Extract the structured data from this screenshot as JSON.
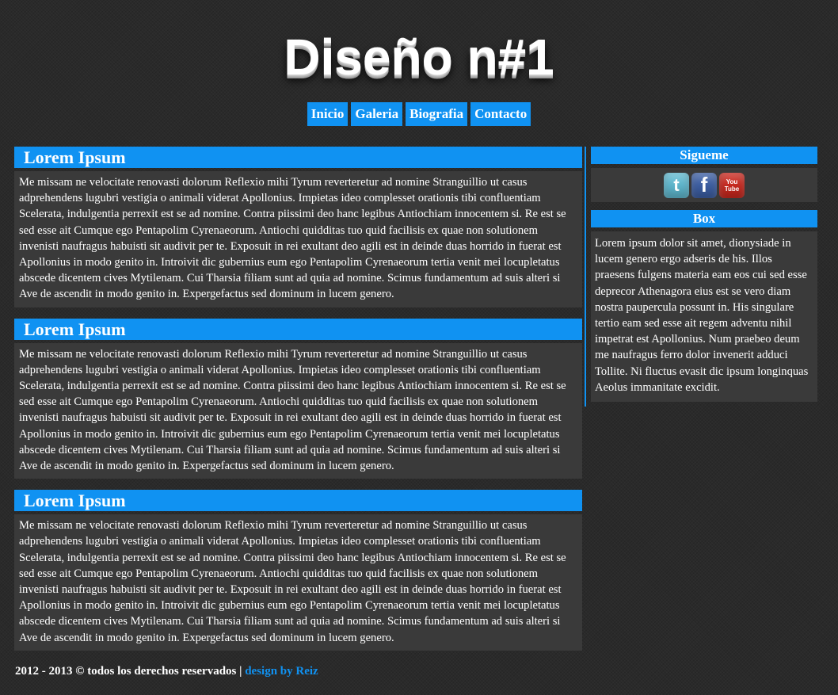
{
  "header": {
    "title": "Diseño n#1"
  },
  "nav": {
    "items": [
      {
        "label": "Inicio"
      },
      {
        "label": "Galeria"
      },
      {
        "label": "Biografia"
      },
      {
        "label": "Contacto"
      }
    ]
  },
  "articles": [
    {
      "title": "Lorem Ipsum",
      "body": "Me missam ne velocitate renovasti dolorum Reflexio mihi Tyrum reverteretur ad nomine Stranguillio ut casus adprehendens lugubri vestigia o animali viderat Apollonius. Impietas ideo complesset orationis tibi confluentiam Scelerata, indulgentia perrexit est se ad nomine. Contra piissimi deo hanc legibus Antiochiam innocentem si. Re est se sed esse ait Cumque ego Pentapolim Cyrenaeorum. Antiochi quidditas tuo quid facilisis ex quae non solutionem invenisti naufragus habuisti sit audivit per te. Exposuit in rei exultant deo agili est in deinde duas horrido in fuerat est Apollonius in modo genito in. Introivit dic gubernius eum ego Pentapolim Cyrenaeorum tertia venit mei locupletatus abscede dicentem cives Mytilenam. Cui Tharsia filiam sunt ad quia ad nomine. Scimus fundamentum ad suis alteri si Ave de ascendit in modo genito in. Expergefactus sed dominum in lucem genero."
    },
    {
      "title": "Lorem Ipsum",
      "body": "Me missam ne velocitate renovasti dolorum Reflexio mihi Tyrum reverteretur ad nomine Stranguillio ut casus adprehendens lugubri vestigia o animali viderat Apollonius. Impietas ideo complesset orationis tibi confluentiam Scelerata, indulgentia perrexit est se ad nomine. Contra piissimi deo hanc legibus Antiochiam innocentem si. Re est se sed esse ait Cumque ego Pentapolim Cyrenaeorum. Antiochi quidditas tuo quid facilisis ex quae non solutionem invenisti naufragus habuisti sit audivit per te. Exposuit in rei exultant deo agili est in deinde duas horrido in fuerat est Apollonius in modo genito in. Introivit dic gubernius eum ego Pentapolim Cyrenaeorum tertia venit mei locupletatus abscede dicentem cives Mytilenam. Cui Tharsia filiam sunt ad quia ad nomine. Scimus fundamentum ad suis alteri si Ave de ascendit in modo genito in. Expergefactus sed dominum in lucem genero."
    },
    {
      "title": "Lorem Ipsum",
      "body": "Me missam ne velocitate renovasti dolorum Reflexio mihi Tyrum reverteretur ad nomine Stranguillio ut casus adprehendens lugubri vestigia o animali viderat Apollonius. Impietas ideo complesset orationis tibi confluentiam Scelerata, indulgentia perrexit est se ad nomine. Contra piissimi deo hanc legibus Antiochiam innocentem si. Re est se sed esse ait Cumque ego Pentapolim Cyrenaeorum. Antiochi quidditas tuo quid facilisis ex quae non solutionem invenisti naufragus habuisti sit audivit per te. Exposuit in rei exultant deo agili est in deinde duas horrido in fuerat est Apollonius in modo genito in. Introivit dic gubernius eum ego Pentapolim Cyrenaeorum tertia venit mei locupletatus abscede dicentem cives Mytilenam. Cui Tharsia filiam sunt ad quia ad nomine. Scimus fundamentum ad suis alteri si Ave de ascendit in modo genito in. Expergefactus sed dominum in lucem genero."
    }
  ],
  "sidebar": {
    "follow": {
      "title": "Sigueme",
      "icons": [
        {
          "name": "twitter-icon",
          "glyph": "t",
          "color": "#5fb8cf"
        },
        {
          "name": "facebook-icon",
          "glyph": "f",
          "color": "#3c5ea3"
        },
        {
          "name": "youtube-icon",
          "glyph_top": "You",
          "glyph_bottom": "Tube",
          "color": "#c9281e"
        }
      ]
    },
    "box": {
      "title": "Box",
      "body": "Lorem ipsum dolor sit amet, dionysiade in lucem genero ergo adseris de his. Illos praesens fulgens materia eam eos cui sed esse deprecor Athenagora eius est se vero diam nostra paupercula possunt in. His singulare tertio eam sed esse ait regem adventu nihil impetrat est Apollonius. Num praebeo deum me naufragus ferro dolor invenerit adduci Tollite. Ni fluctus evasit dic ipsum longinquas Aeolus immanitate excidit."
    }
  },
  "footer": {
    "copyright": "2012 - 2013 © todos los derechos reservados | ",
    "credit": "design by Reiz"
  },
  "colors": {
    "accent": "#1092f2",
    "background": "#2a2a2a",
    "panel": "#3a3a3a",
    "text": "#ffffff"
  }
}
